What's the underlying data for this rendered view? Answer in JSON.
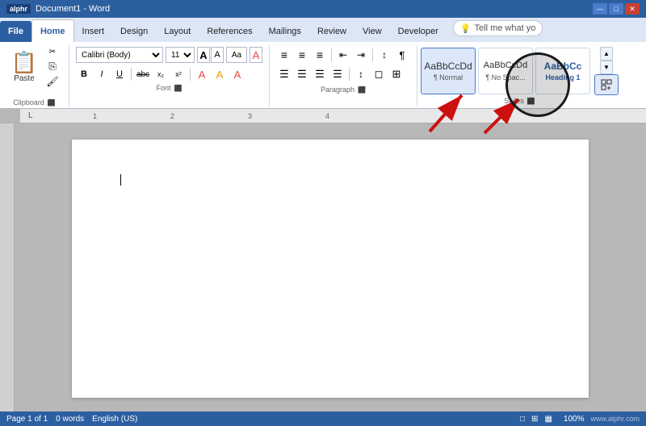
{
  "titlebar": {
    "logo": "alphr",
    "title": "Document1 - Word",
    "controls": [
      "—",
      "□",
      "✕"
    ]
  },
  "tabs": {
    "items": [
      "File",
      "Home",
      "Insert",
      "Design",
      "Layout",
      "References",
      "Mailings",
      "Review",
      "View",
      "Developer"
    ],
    "active": "Home"
  },
  "tellme": {
    "placeholder": "Tell me what yo",
    "icon": "💡"
  },
  "clipboard": {
    "paste_label": "Paste",
    "cut_icon": "✂",
    "copy_icon": "⎘",
    "format_icon": "🖌"
  },
  "font": {
    "name": "Calibri (Body)",
    "size": "11",
    "grow_label": "A",
    "shrink_label": "A",
    "aa_label": "Aa",
    "clear_label": "A",
    "bold": "B",
    "italic": "I",
    "underline": "U",
    "strikethrough": "abc",
    "subscript": "x₂",
    "superscript": "x²",
    "text_highlight": "A",
    "font_color": "A",
    "label": "Font"
  },
  "paragraph": {
    "label": "Paragraph",
    "buttons": [
      "≡",
      "≡",
      "≡",
      "≡",
      "≡",
      "☰",
      "☰",
      "☰",
      "☰",
      "↕",
      "¶",
      "◻",
      "⊞"
    ]
  },
  "styles": {
    "label": "Styles",
    "items": [
      {
        "preview": "AaBbCcDd",
        "name": "¶ Normal",
        "type": "normal"
      },
      {
        "preview": "AaBbCcDd",
        "name": "¶ No Spac...",
        "type": "nospace"
      },
      {
        "preview": "AaBbCc",
        "name": "Heading 1",
        "type": "heading"
      }
    ],
    "expand_label": "⬛",
    "nav_up": "▲",
    "nav_down": "▼"
  },
  "ruler": {
    "markers": [
      "L",
      "1",
      "2",
      "3",
      "4"
    ]
  },
  "document": {
    "content": ""
  },
  "statusbar": {
    "page": "Page 1 of 1",
    "words": "0 words",
    "language": "English (US)",
    "view_icons": [
      "□",
      "⊞",
      "▦"
    ],
    "zoom": "100%",
    "watermark": "www.alphr.com"
  }
}
